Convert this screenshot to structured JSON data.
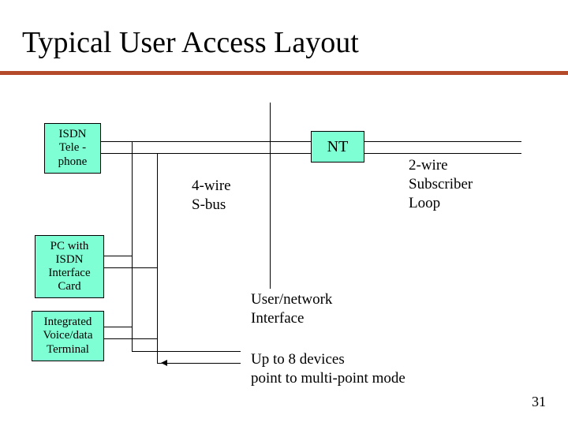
{
  "title": "Typical User Access Layout",
  "nodes": {
    "isdn_phone": {
      "line1": "ISDN",
      "line2": "Tele -",
      "line3": "phone"
    },
    "pc_card": {
      "line1": "PC with",
      "line2": "ISDN",
      "line3": "Interface",
      "line4": "Card"
    },
    "terminal": {
      "line1": "Integrated",
      "line2": "Voice/data",
      "line3": "Terminal"
    },
    "nt": "NT"
  },
  "labels": {
    "sbus_line1": "4-wire",
    "sbus_line2": "S-bus",
    "loop_line1": "2-wire",
    "loop_line2": "Subscriber",
    "loop_line3": "Loop",
    "uni_line1": "User/network",
    "uni_line2": "Interface",
    "note_line1": "Up to 8 devices",
    "note_line2": "point to multi-point mode"
  },
  "page_number": "31"
}
